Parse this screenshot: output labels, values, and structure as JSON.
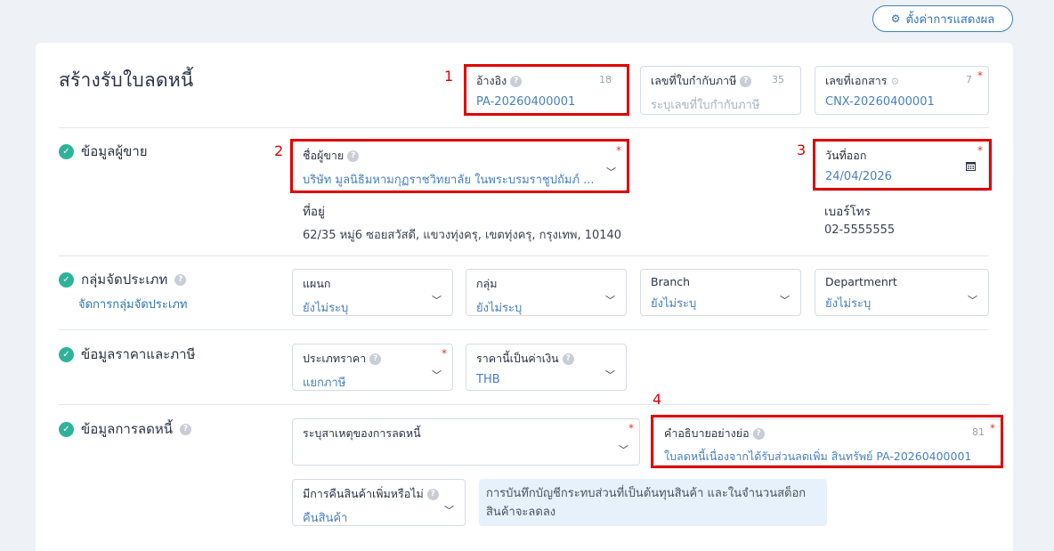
{
  "top_button": {
    "icon": "gear-icon",
    "label": "ตั้งค่าการแสดงผล"
  },
  "page_title": "สร้างรับใบลดหนี้",
  "header_fields": {
    "reference": {
      "label": "อ้างอิง",
      "value": "PA-20260400001",
      "count": "18"
    },
    "tax_invoice": {
      "label": "เลขที่ใบกำกับภาษี",
      "placeholder": "ระบุเลขที่ใบกำกับภาษี",
      "count": "35"
    },
    "doc_number": {
      "label": "เลขที่เอกสาร",
      "value": "CNX-20260400001",
      "count": "7"
    }
  },
  "seller": {
    "section_title": "ข้อมูลผู้ขาย",
    "name_label": "ชื่อผู้ขาย",
    "name_value": "บริษัท มูลนิธิมหามกุฏราชวิทยาลัย ในพระบรมราชูปถัมภ์ ...",
    "date_label": "วันที่ออก",
    "date_value": "24/04/2026",
    "address_label": "ที่อยู่",
    "address_value": "62/35 หมู่6 ซอยสวัสดี, แขวงทุ่งครุ, เขตทุ่งครุ, กรุงเทพ, 10140",
    "phone_label": "เบอร์โทร",
    "phone_value": "02-5555555"
  },
  "category": {
    "section_title": "กลุ่มจัดประเภท",
    "manage_link": "จัดการกลุ่มจัดประเภท",
    "fields": [
      {
        "label": "แผนก",
        "value": "ยังไม่ระบุ"
      },
      {
        "label": "กลุ่ม",
        "value": "ยังไม่ระบุ"
      },
      {
        "label": "Branch",
        "value": "ยังไม่ระบุ"
      },
      {
        "label": "Departmenrt",
        "value": "ยังไม่ระบุ"
      }
    ]
  },
  "pricing": {
    "section_title": "ข้อมูลราคาและภาษี",
    "price_type_label": "ประเภทราคา",
    "price_type_value": "แยกภาษี",
    "currency_label": "ราคานี้เป็นค่าเงิน",
    "currency_value": "THB"
  },
  "credit_note": {
    "section_title": "ข้อมูลการลดหนี้",
    "reason_label": "ระบุสาเหตุของการลดหนี้",
    "desc_label": "คำอธิบายอย่างย่อ",
    "desc_value": "ใบลดหนี้เนื่องจากได้รับส่วนลดเพิ่ม สินทรัพย์ PA-20260400001",
    "desc_count": "81",
    "return_label": "มีการคืนสินค้าเพิ่มหรือไม่",
    "return_value": "คืนสินค้า",
    "note": "การบันทึกบัญชีกระทบส่วนที่เป็นต้นทุนสินค้า และในจำนวนสต็อกสินค้าจะลดลง"
  },
  "markers": [
    "1",
    "2",
    "3",
    "4"
  ],
  "colors": {
    "accent": "#2f74b8",
    "highlight": "#e00000",
    "check": "#2eb39a",
    "required": "#e0392b"
  }
}
